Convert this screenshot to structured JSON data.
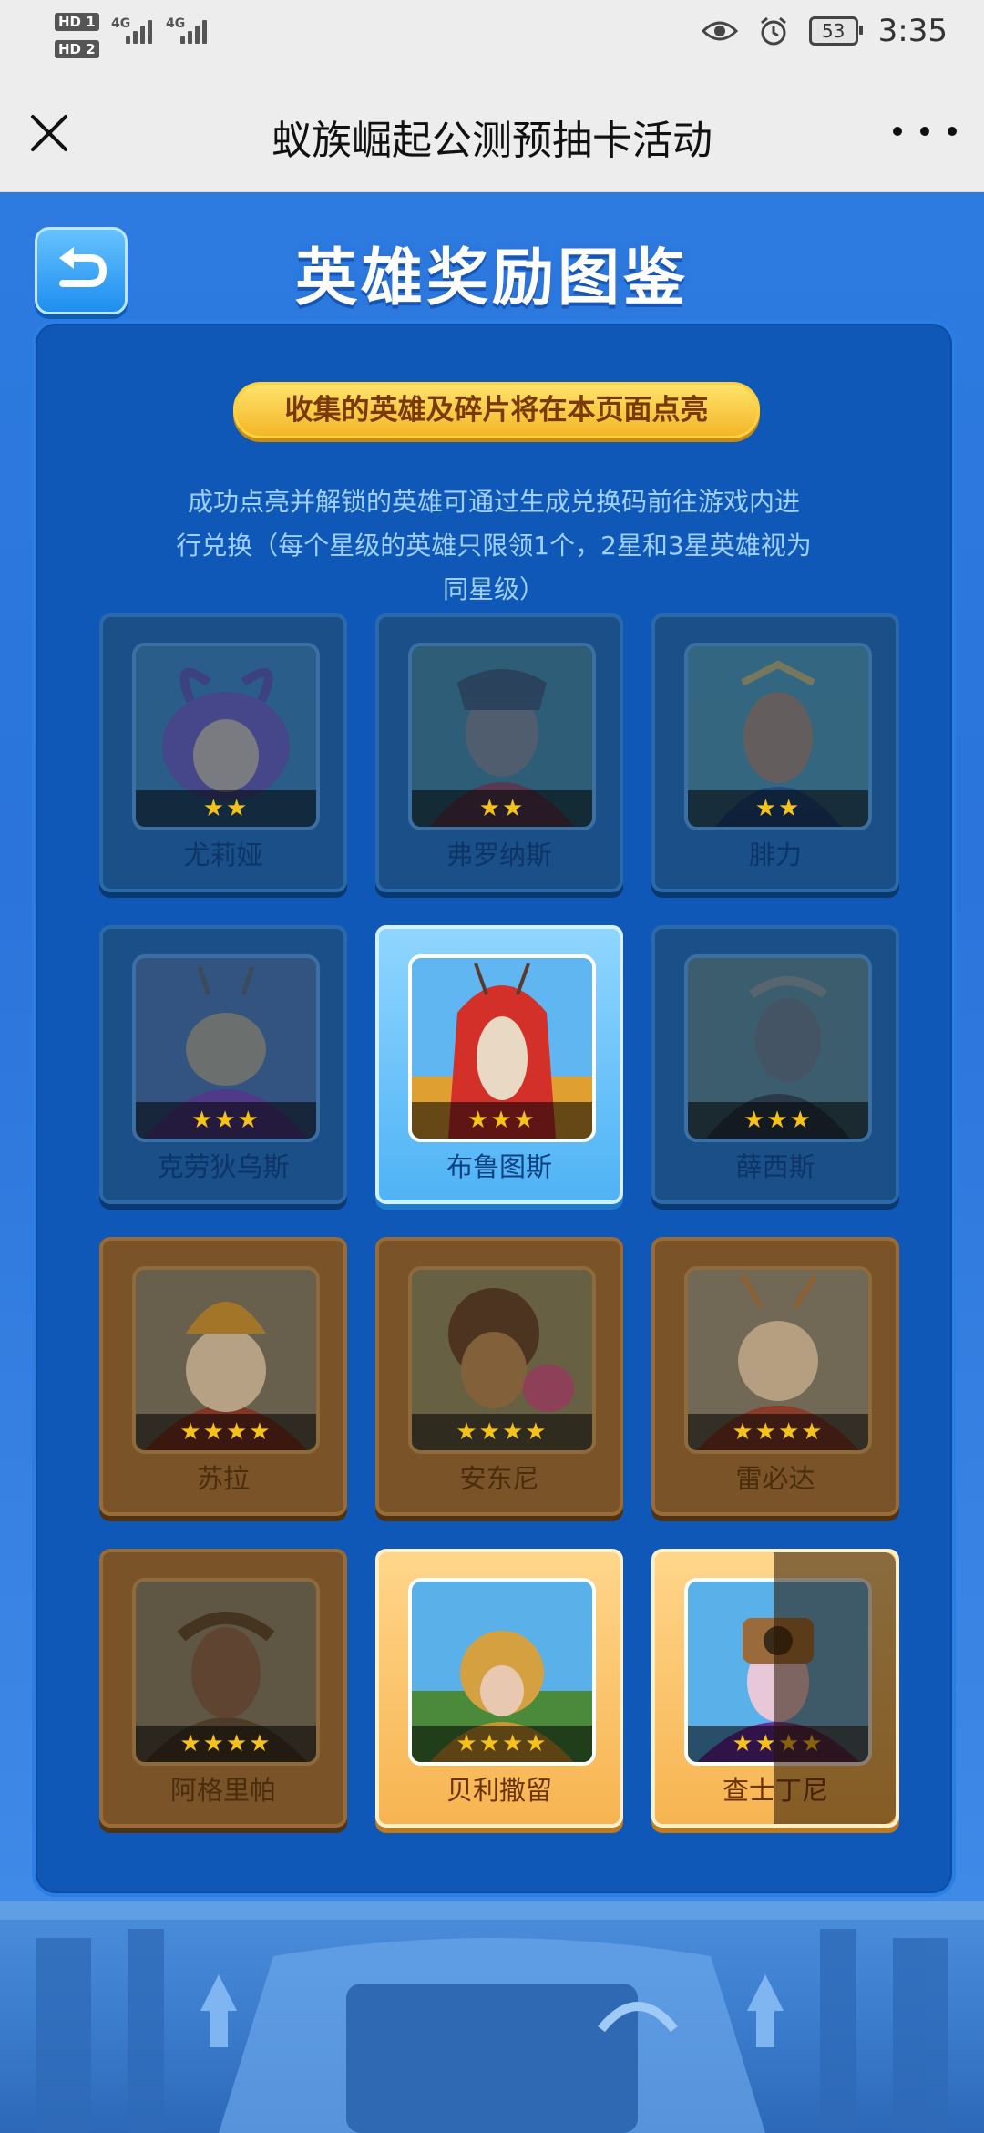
{
  "status_bar": {
    "sim1": "HD 1",
    "sim2": "HD 2",
    "net1": "4G",
    "net2": "4G",
    "battery": "53",
    "time": "3:35"
  },
  "title_bar": {
    "title": "蚁族崛起公测预抽卡活动"
  },
  "header": {
    "title": "英雄奖励图鉴"
  },
  "banner": "收集的英雄及碎片将在本页面点亮",
  "description": [
    "成功点亮并解锁的英雄可通过生成兑换码前往游戏内进",
    "行兑换（每个星级的英雄只限领1个，2星和3星英雄视为",
    "同星级）"
  ],
  "heroes": [
    {
      "name": "尤莉娅",
      "stars": "★★",
      "state": "locked"
    },
    {
      "name": "弗罗纳斯",
      "stars": "★★",
      "state": "locked"
    },
    {
      "name": "腓力",
      "stars": "★★",
      "state": "locked"
    },
    {
      "name": "克劳狄乌斯",
      "stars": "★★★",
      "state": "locked"
    },
    {
      "name": "布鲁图斯",
      "stars": "★★★",
      "state": "unlocked"
    },
    {
      "name": "薛西斯",
      "stars": "★★★",
      "state": "locked"
    },
    {
      "name": "苏拉",
      "stars": "★★★★",
      "state": "locked"
    },
    {
      "name": "安东尼",
      "stars": "★★★★",
      "state": "locked"
    },
    {
      "name": "雷必达",
      "stars": "★★★★",
      "state": "locked"
    },
    {
      "name": "阿格里帕",
      "stars": "★★★★",
      "state": "locked"
    },
    {
      "name": "贝利撒留",
      "stars": "★★★★",
      "state": "unlocked"
    },
    {
      "name": "查士丁尼",
      "stars": "★★★★",
      "state": "partial"
    }
  ]
}
